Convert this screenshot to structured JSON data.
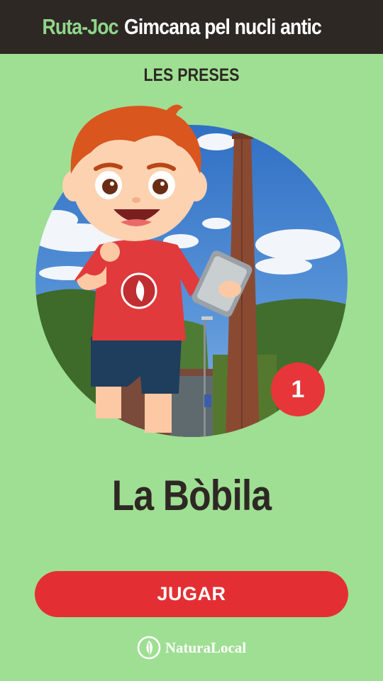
{
  "header": {
    "brand": "Ruta-Joc",
    "subtitle": "Gimcana pel nucli antic",
    "brand_color": "#8fd68a",
    "background_color": "#2e2824"
  },
  "location": "LES PRESES",
  "stage": {
    "number": "1",
    "title": "La Bòbila",
    "badge_color": "#e6363a"
  },
  "play_button": {
    "label": "JUGAR",
    "color": "#e32f33"
  },
  "footer": {
    "logo_icon": "leaf-icon",
    "logo_text": "NaturaLocal"
  },
  "page_background": "#9fdf93"
}
